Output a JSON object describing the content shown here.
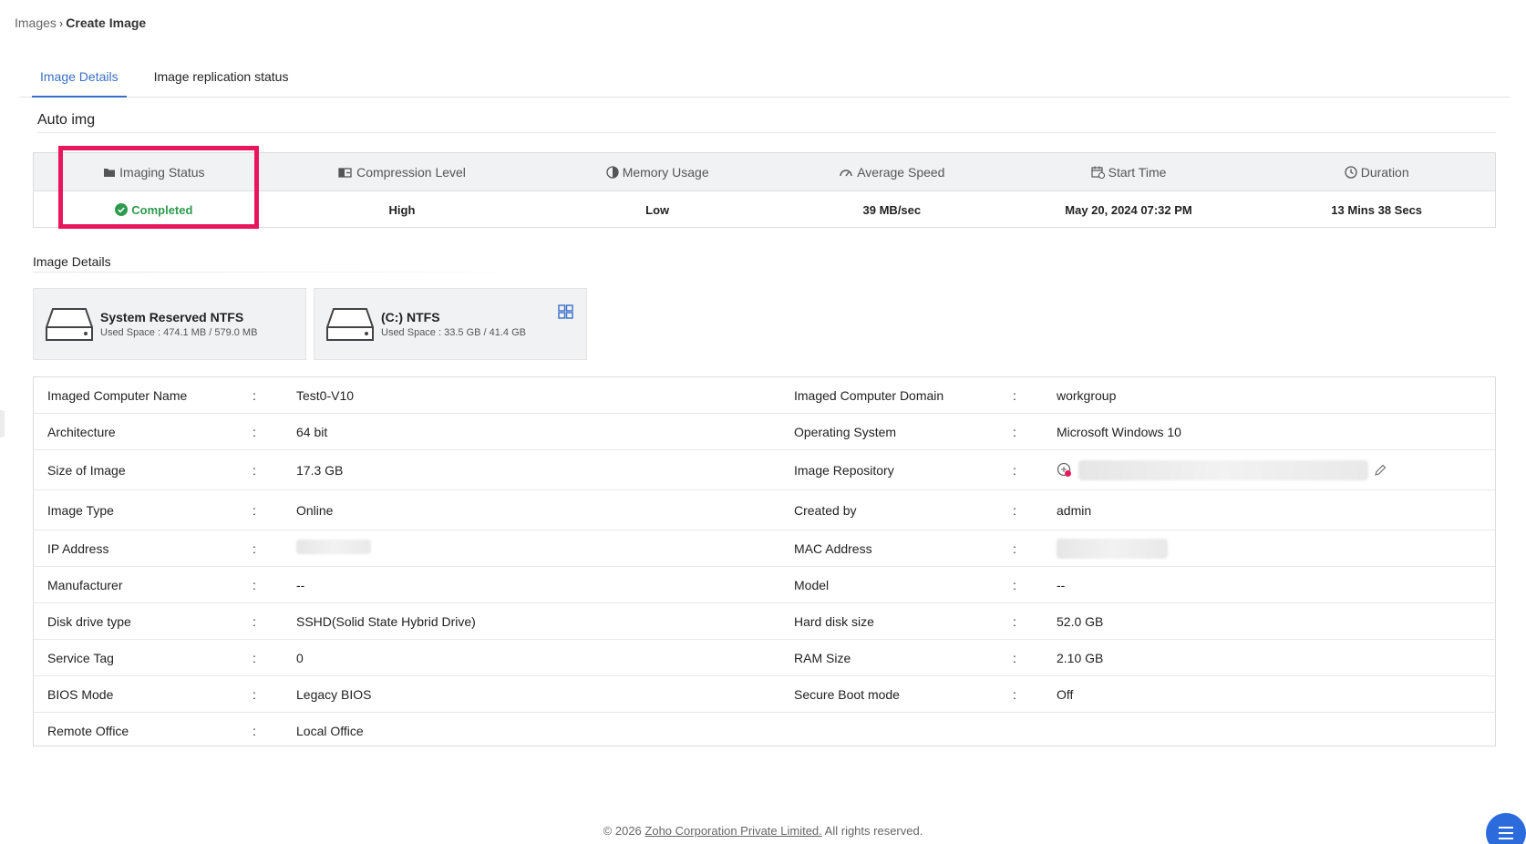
{
  "breadcrumb": {
    "root": "Images",
    "current": "Create Image"
  },
  "tabs": [
    {
      "label": "Image Details",
      "active": true
    },
    {
      "label": "Image replication status",
      "active": false
    }
  ],
  "image_name": "Auto img",
  "status": {
    "headers": [
      "Imaging Status",
      "Compression Level",
      "Memory Usage",
      "Average Speed",
      "Start Time",
      "Duration"
    ],
    "values": [
      "Completed",
      "High",
      "Low",
      "39 MB/sec",
      "May 20, 2024 07:32 PM",
      "13 Mins 38 Secs"
    ],
    "status_color": "#2e9a4f",
    "highlight_color": "#e8175d"
  },
  "image_details_title": "Image Details",
  "disks": [
    {
      "name": "System Reserved NTFS",
      "space": "Used Space : 474.1 MB / 579.0 MB"
    },
    {
      "name": "(C:) NTFS",
      "space": "Used Space : 33.5 GB / 41.4 GB"
    }
  ],
  "details": [
    {
      "l1": "Imaged Computer Name",
      "v1": "Test0-V10",
      "l2": "Imaged Computer Domain",
      "v2": "workgroup"
    },
    {
      "l1": "Architecture",
      "v1": "64 bit",
      "l2": "Operating System",
      "v2": "Microsoft Windows 10"
    },
    {
      "l1": "Size of Image",
      "v1": "17.3 GB",
      "l2": "Image Repository",
      "v2": ""
    },
    {
      "l1": "Image Type",
      "v1": "Online",
      "l2": "Created by",
      "v2": "admin"
    },
    {
      "l1": "IP Address",
      "v1": "",
      "l2": "MAC Address",
      "v2": ""
    },
    {
      "l1": "Manufacturer",
      "v1": "--",
      "l2": "Model",
      "v2": "--"
    },
    {
      "l1": "Disk drive type",
      "v1": "SSHD(Solid State Hybrid Drive)",
      "l2": "Hard disk size",
      "v2": "52.0 GB"
    },
    {
      "l1": "Service Tag",
      "v1": "0",
      "l2": "RAM Size",
      "v2": "2.10 GB"
    },
    {
      "l1": "BIOS Mode",
      "v1": "Legacy BIOS",
      "l2": "Secure Boot mode",
      "v2": "Off"
    },
    {
      "l1": "Remote Office",
      "v1": "Local Office",
      "l2": "",
      "v2": ""
    }
  ],
  "separator": ":",
  "footer": {
    "prefix": "© 2026 ",
    "link": "Zoho Corporation Private Limited.",
    "suffix": " All rights reserved."
  },
  "accent_color": "#3a6fc9"
}
